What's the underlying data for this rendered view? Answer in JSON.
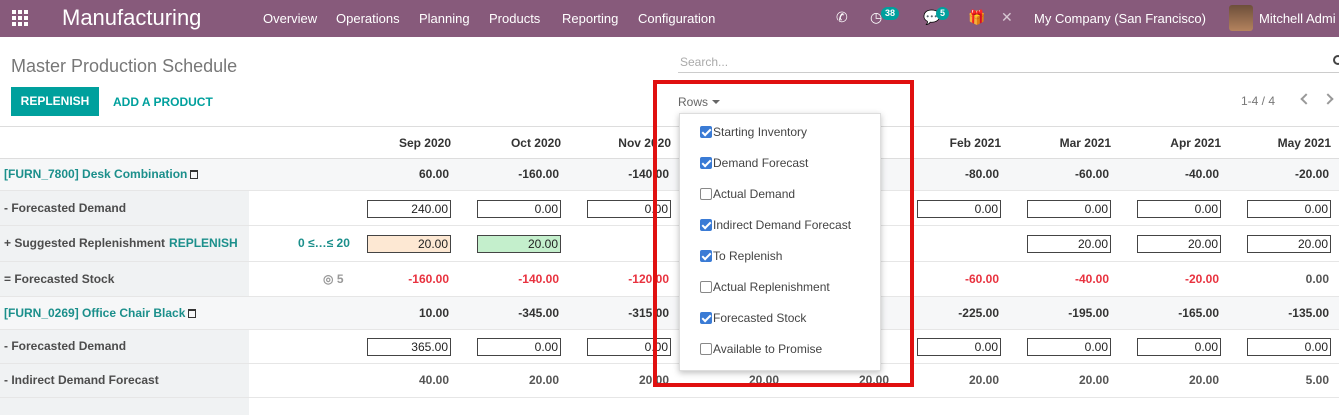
{
  "navbar": {
    "app_name": "Manufacturing",
    "menu": [
      "Overview",
      "Operations",
      "Planning",
      "Products",
      "Reporting",
      "Configuration"
    ],
    "activity_count": "38",
    "message_count": "5",
    "company": "My Company (San Francisco)",
    "user": "Mitchell Admi"
  },
  "control_panel": {
    "title": "Master Production Schedule",
    "search_placeholder": "Search...",
    "replenish_label": "REPLENISH",
    "add_product_label": "ADD A PRODUCT",
    "rows_label": "Rows",
    "pager": "1-4 / 4"
  },
  "months": [
    "Sep 2020",
    "Oct 2020",
    "Nov 2020",
    "",
    "",
    "Feb 2021",
    "Mar 2021",
    "Apr 2021",
    "May 2021"
  ],
  "rows_menu": [
    {
      "label": "Starting Inventory",
      "checked": true
    },
    {
      "label": "Demand Forecast",
      "checked": true
    },
    {
      "label": "Actual Demand",
      "checked": false
    },
    {
      "label": "Indirect Demand Forecast",
      "checked": true
    },
    {
      "label": "To Replenish",
      "checked": true
    },
    {
      "label": "Actual Replenishment",
      "checked": false
    },
    {
      "label": "Forecasted Stock",
      "checked": true
    },
    {
      "label": "Available to Promise",
      "checked": false
    }
  ],
  "table": {
    "rows": [
      {
        "label": "[FURN_7800] Desk Combination",
        "kind": "product",
        "aux": "",
        "cells": [
          "60.00",
          "-160.00",
          "-140.00",
          "",
          "",
          "-80.00",
          "-60.00",
          "-40.00",
          "-20.00"
        ]
      },
      {
        "label": "- Forecasted Demand",
        "kind": "input",
        "aux": "",
        "cells": [
          "240.00",
          "0.00",
          "0.00",
          "",
          "",
          "0.00",
          "0.00",
          "0.00",
          "0.00"
        ]
      },
      {
        "label": "+ Suggested Replenishment",
        "link": "REPLENISH",
        "kind": "replenish",
        "aux": "0 ≤…≤ 20",
        "cells": [
          "20.00",
          "20.00",
          "",
          "",
          "",
          "",
          "20.00",
          "20.00",
          "20.00"
        ]
      },
      {
        "label": "= Forecasted Stock",
        "kind": "stock",
        "aux": "5",
        "cells": [
          "-160.00",
          "-140.00",
          "-120.00",
          "",
          "",
          "-60.00",
          "-40.00",
          "-20.00",
          "0.00"
        ]
      },
      {
        "label": "[FURN_0269] Office Chair Black",
        "kind": "product",
        "aux": "",
        "cells": [
          "10.00",
          "-345.00",
          "-315.00",
          "",
          "",
          "-225.00",
          "-195.00",
          "-165.00",
          "-135.00"
        ]
      },
      {
        "label": "- Forecasted Demand",
        "kind": "input",
        "aux": "",
        "cells": [
          "365.00",
          "0.00",
          "0.00",
          "",
          "",
          "0.00",
          "0.00",
          "0.00",
          "0.00"
        ]
      },
      {
        "label": "- Indirect Demand Forecast",
        "kind": "text",
        "aux": "",
        "cells": [
          "40.00",
          "20.00",
          "20.00",
          "20.00",
          "20.00",
          "20.00",
          "20.00",
          "20.00",
          "5.00"
        ]
      }
    ]
  }
}
